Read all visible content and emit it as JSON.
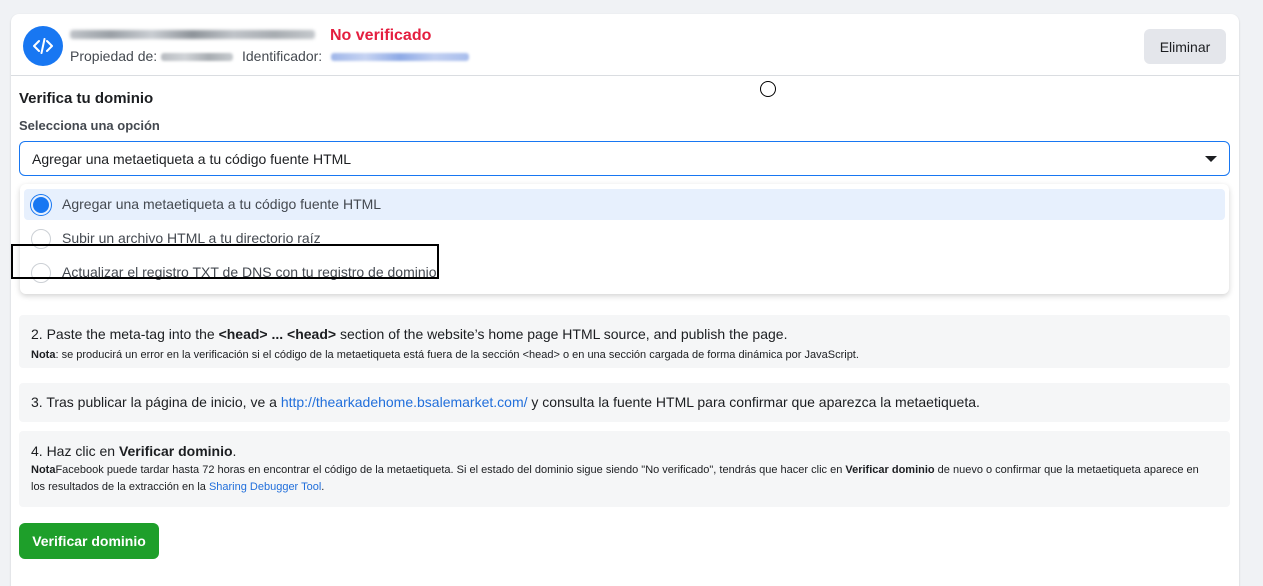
{
  "header": {
    "status": "No verificado",
    "property_label": "Propiedad de:",
    "id_label": "Identificador:",
    "delete_button": "Eliminar",
    "icon": "code-icon"
  },
  "verify": {
    "title": "Verifica tu dominio",
    "select_label": "Selecciona una opción",
    "selected_value": "Agregar una metaetiqueta a tu código fuente HTML",
    "options": [
      {
        "label": "Agregar una metaetiqueta a tu código fuente HTML",
        "selected": true
      },
      {
        "label": "Subir un archivo HTML a tu directorio raíz",
        "selected": false
      },
      {
        "label": "Actualizar el registro TXT de DNS con tu registro de dominio",
        "selected": false
      }
    ]
  },
  "steps": {
    "step2": {
      "prefix": "2. Paste the meta-tag into the ",
      "bold1": "<head> ... <head>",
      "suffix": " section of the website’s home page HTML source, and publish the page.",
      "note_bold": "Nota",
      "note_text": ": se producirá un error en la verificación si el código de la metaetiqueta está fuera de la sección <head> o en una sección cargada de forma dinámica por JavaScript."
    },
    "step3": {
      "prefix": "3. Tras publicar la página de inicio, ve a ",
      "link": "http://thearkadehome.bsalemarket.com/",
      "suffix": " y consulta la fuente HTML para confirmar que aparezca la metaetiqueta."
    },
    "step4": {
      "prefix": "4. Haz clic en ",
      "bold": "Verificar dominio",
      "suffix": ".",
      "note_bold": "Nota",
      "note_text1": "Facebook puede tardar hasta 72 horas en encontrar el código de la metaetiqueta. Si el estado del dominio sigue siendo \"No verificado\", tendrás que hacer clic en ",
      "note_bold2": "Verificar dominio",
      "note_text2": " de nuevo o confirmar que la metaetiqueta aparece en los resultados de la extracción en la ",
      "note_link": "Sharing Debugger Tool",
      "note_end": "."
    }
  },
  "verify_button": "Verificar dominio",
  "colors": {
    "accent": "#1877f2",
    "status_red": "#e41e3f",
    "verify_green": "#1e9f2a",
    "link": "#216fdb"
  }
}
